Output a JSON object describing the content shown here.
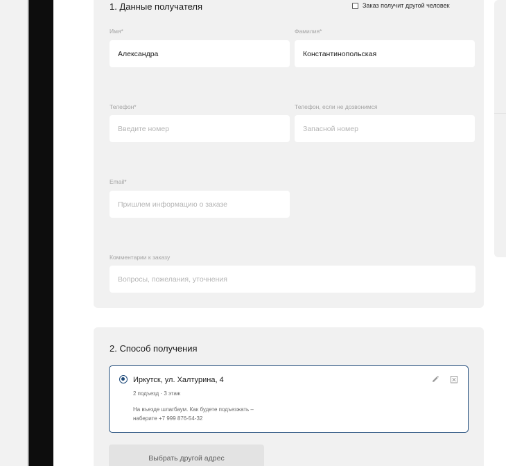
{
  "section1": {
    "title": "1. Данные получателя",
    "other_person_label": "Заказ получит другой человек",
    "first_name": {
      "label": "Имя*",
      "value": "Александра"
    },
    "last_name": {
      "label": "Фамилия*",
      "value": "Константинопольская"
    },
    "phone": {
      "label": "Телефон*",
      "placeholder": "Введите номер"
    },
    "phone_backup": {
      "label": "Телефон, если не дозвонимся",
      "placeholder": "Запасной номер"
    },
    "email": {
      "label": "Email*",
      "placeholder": "Пришлем информацию о заказе"
    },
    "comment": {
      "label": "Комментарии к заказу",
      "placeholder": "Вопросы, пожелания, уточнения"
    }
  },
  "section2": {
    "title": "2. Способ получения",
    "address": {
      "title": "Иркутск, ул. Халтурина, 4",
      "details": "2 подъезд · 3 этаж",
      "note_line1": "На въезде шлагбаум. Как будете подъезжать –",
      "note_line2": "наберите +7 999 876-54-32"
    },
    "other_address_button": "Выбрать другой адрес"
  },
  "colors": {
    "accent": "#1e4a7a",
    "card_bg": "#f1f1f1"
  },
  "icons": {
    "edit": "pencil-icon",
    "delete": "delete-box-icon"
  }
}
